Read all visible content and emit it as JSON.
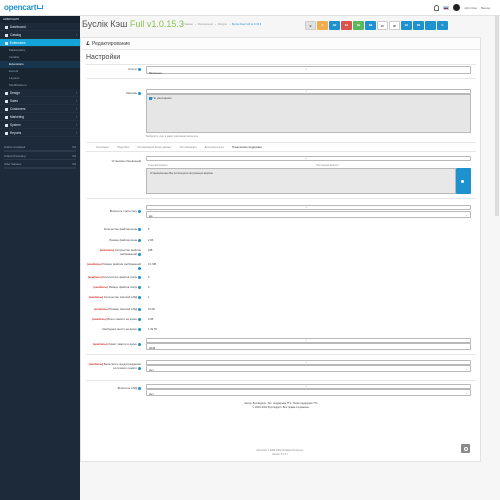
{
  "topbar": {
    "logo": "opencart",
    "user": "John Doe",
    "logout": "Выход"
  },
  "sidebar": {
    "nav_head": "НАВИГАЦИЯ",
    "items": [
      {
        "label": "Dashboard",
        "icon": "dashboard-icon"
      },
      {
        "label": "Catalog",
        "icon": "tag-icon"
      },
      {
        "label": "Extensions",
        "icon": "puzzle-icon"
      }
    ],
    "sub_items": [
      "Marketplace",
      "Installer",
      "Extensions",
      "Events",
      "Layouts",
      "Modifications"
    ],
    "items2": [
      {
        "label": "Design",
        "icon": "monitor-icon"
      },
      {
        "label": "Sales",
        "icon": "cart-icon"
      },
      {
        "label": "Customers",
        "icon": "user-icon"
      },
      {
        "label": "Marketing",
        "icon": "share-icon"
      },
      {
        "label": "System",
        "icon": "cog-icon"
      },
      {
        "label": "Reports",
        "icon": "chart-icon"
      }
    ],
    "stats": [
      {
        "label": "Orders Completed",
        "value": "0%"
      },
      {
        "label": "Orders Processing",
        "value": "0%"
      },
      {
        "label": "Other Statuses",
        "value": "0%"
      }
    ]
  },
  "header": {
    "title_main": "Буслік Кэш",
    "title_full": "Full",
    "title_ver": "v1.0.15.3",
    "breadcrumb": [
      "Главная",
      "Расширения",
      "Модули",
      "Буслік Кэш Full v1.0.15.3"
    ],
    "buttons": [
      {
        "label": "B",
        "color": "#e2e2e2",
        "text": "#555"
      },
      {
        "label": "☆",
        "color": "#f0ad4e",
        "text": "#fff"
      },
      {
        "label": "АВ",
        "color": "#1e91cf",
        "text": "#fff"
      },
      {
        "label": "ЗА",
        "color": "#d9534f",
        "text": "#fff"
      },
      {
        "label": "ЗБ",
        "color": "#5cb85c",
        "text": "#fff"
      },
      {
        "label": "АВ",
        "color": "#1e91cf",
        "text": "#fff"
      },
      {
        "label": "ЗС",
        "color": "#fff",
        "text": "#555"
      },
      {
        "label": "ЗР",
        "color": "#fff",
        "text": "#555"
      },
      {
        "label": "ЗА",
        "color": "#1e91cf",
        "text": "#fff"
      },
      {
        "label": "ЗВ",
        "color": "#1e91cf",
        "text": "#fff"
      },
      {
        "label": "↑",
        "color": "#1e91cf",
        "text": "#fff"
      },
      {
        "label": "↻",
        "color": "#1e91cf",
        "text": "#fff"
      }
    ]
  },
  "panel": {
    "heading": "Редактирование",
    "section": "Настройки",
    "status_label": "Статус",
    "status_value": "Включено",
    "stores_label": "Магазин",
    "stores_option": "По умолчанию",
    "stores_hint": "Выберите, кэш в каких магазинах включать",
    "tabs": [
      "Основные",
      "Подробно",
      "Оптимизация Кеша данных",
      "Оптимизация",
      "Дополнительно",
      "Техническая поддержка"
    ],
    "updates_label": "Установка обновлений",
    "updates_cur": "Текущая версия",
    "updates_latest": "Последняя версия",
    "updates_text": "Установленные Вы используете актуальную версию",
    "stat_label": "Включить статистику",
    "stat_value": "Да",
    "rows": [
      {
        "label": "Количество файлов кэша",
        "value": "5",
        "warn": ""
      },
      {
        "label": "Размер файлов кэша",
        "value": "2 КБ",
        "warn": ""
      },
      {
        "label": "Количество файлов изображений",
        "value": "188",
        "warn": "(кешбисы)"
      },
      {
        "label": "Размер файлов изображений",
        "value": "3.1 МБ",
        "warn": "(кешбисы)"
      },
      {
        "label": "Количество файлов css/js",
        "value": "0",
        "warn": "(кешбисы)"
      },
      {
        "label": "Размер файлов css/js",
        "value": "0",
        "warn": "(кешбисы)"
      },
      {
        "label": "Количество записей в БД",
        "value": "1",
        "warn": "(кешбисы)"
      },
      {
        "label": "Размер записей в БД",
        "value": "16 КБ",
        "warn": "(кешбисы)"
      },
      {
        "label": "Всего памяти на диске",
        "value": "4.6Б",
        "warn": "(кешбисы)"
      },
      {
        "label": "Свободное место на диске",
        "value": "1.49 ГБ",
        "warn": ""
      }
    ],
    "lifetime_label": "Лимит памяти в диске",
    "lifetime_warn": "(кешбисы)",
    "lifetime_value": "2048",
    "predl_label": "Выполнять предупреждение если мало памяти",
    "predl_warn": "(кешбисы)",
    "predl_value": "Нет",
    "bd_label": "Включить в БД",
    "bd_value": "Нет",
    "author_line": "Автор: Буслікдроп. Тех. поддержка ТГ1. Тема поддержки ТГ1",
    "copyright_line": "© 2016-2022 Буслікдроп. Все права сохранены.",
    "foot_line1": "OpenCart © 2009-2022 All Rights Reserved.",
    "foot_line2": "Version 3.0.3.7"
  },
  "colors": {
    "accent": "#1e91cf",
    "sidebar": "#1d2a3a",
    "active": "#15a4d7",
    "success": "#8bc34a",
    "warn": "#d0312d"
  }
}
